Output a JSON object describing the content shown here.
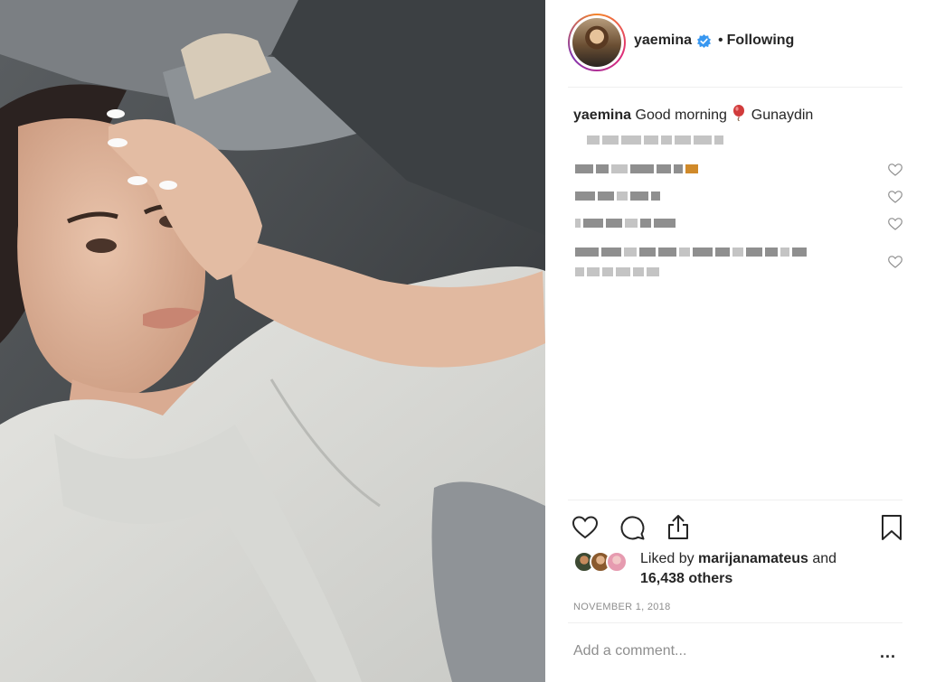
{
  "post": {
    "username": "yaemina",
    "follow_status": "Following",
    "separator_dot": "•",
    "caption_user": "yaemina",
    "caption_text_1": "Good morning",
    "caption_text_2": "Gunaydin",
    "liked_by_prefix": "Liked by",
    "liked_by_user": "marijanamateus",
    "liked_by_and": "and",
    "liked_by_others": "16,438 others",
    "date": "NOVEMBER 1, 2018",
    "add_comment_placeholder": "Add a comment...",
    "more_label": "..."
  },
  "icons": {
    "verified": "verified-badge-icon",
    "like": "heart-icon",
    "comment": "comment-icon",
    "share": "share-icon",
    "save": "bookmark-icon",
    "balloon": "balloon-emoji"
  },
  "colors": {
    "verified_blue": "#3897f0",
    "text": "#262626",
    "muted": "#8e8e8e"
  }
}
